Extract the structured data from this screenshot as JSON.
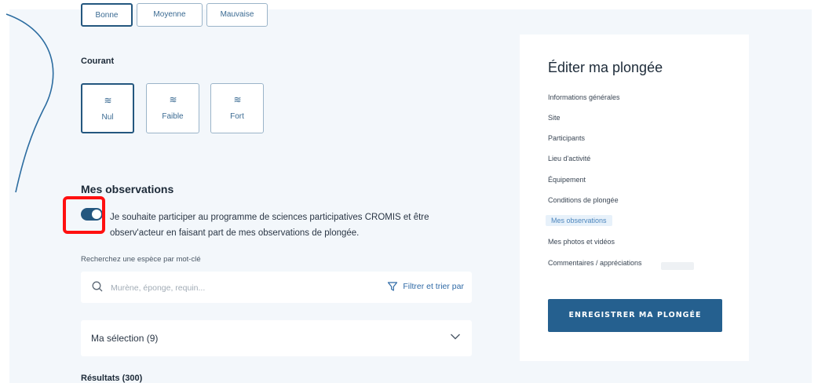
{
  "visibility_options": [
    "Bonne",
    "Moyenne",
    "Mauvaise"
  ],
  "current": {
    "title": "Courant",
    "options": [
      "Nul",
      "Faible",
      "Fort"
    ],
    "selected": "Nul"
  },
  "observations": {
    "title": "Mes observations",
    "toggle_on": true,
    "consent_text": "Je souhaite participer au programme de sciences participatives CROMIS et être observ'acteur en faisant part de mes observations de plongée.",
    "search_label": "Recherchez une espèce par mot-clé",
    "search_placeholder": "Murène, éponge, requin...",
    "filter_label": "Filtrer et trier par",
    "selection_label": "Ma sélection (9)",
    "results_label": "Résultats (300)"
  },
  "panel": {
    "title": "Éditer ma plongée",
    "nav": [
      "Informations générales",
      "Site",
      "Participants",
      "Lieu d'activité",
      "Équipement",
      "Conditions de plongée",
      "Mes observations",
      "Mes photos et vidéos",
      "Commentaires / appréciations"
    ],
    "active_index": 6,
    "save_label": "ENREGISTRER MA PLONGÉE"
  },
  "colors": {
    "primary": "#24577f",
    "accent_link": "#2f6aa6",
    "highlight": "#ff1010"
  },
  "icons": [
    "wave-icon",
    "search-icon",
    "filter-icon",
    "chevron-down-icon"
  ]
}
